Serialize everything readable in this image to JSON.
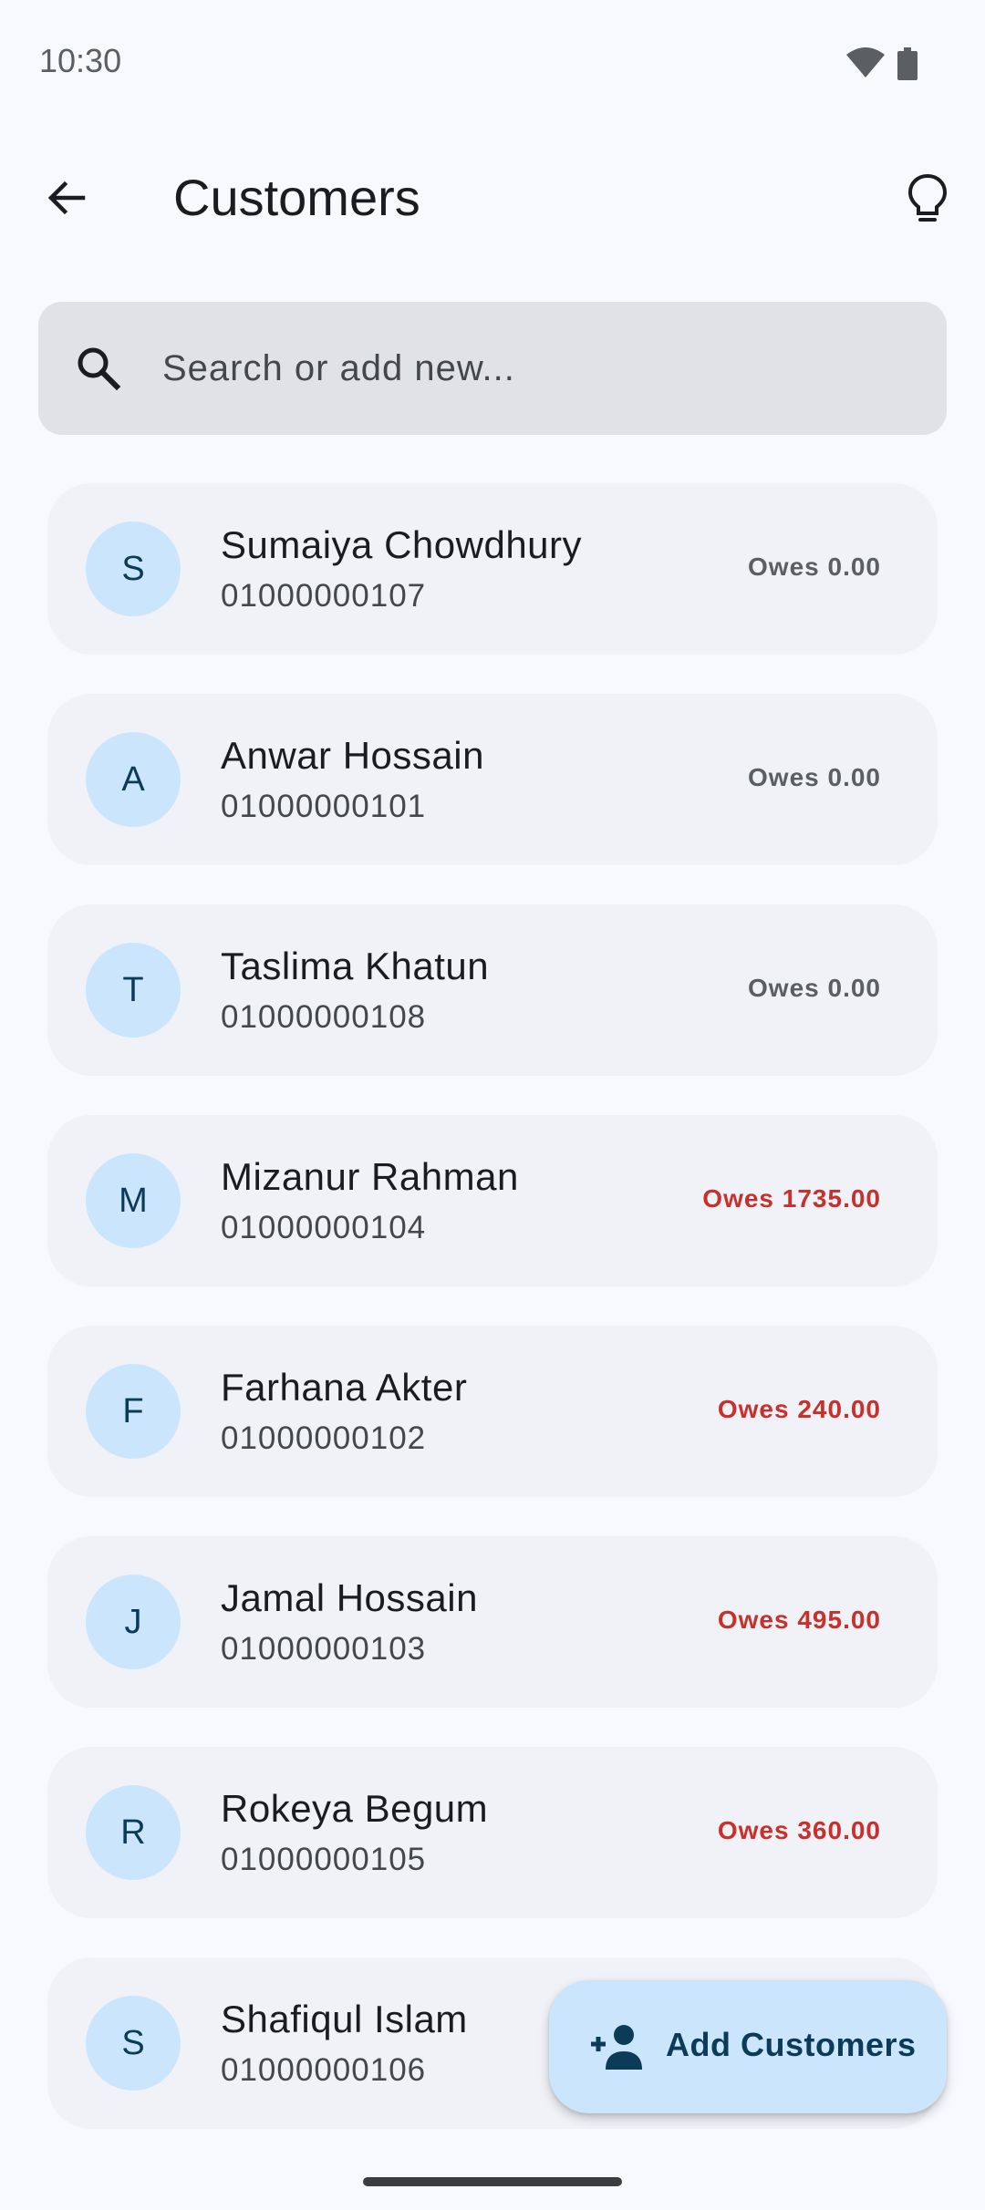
{
  "status_bar": {
    "time": "10:30",
    "icons": [
      "wifi-icon",
      "battery-icon"
    ]
  },
  "app_bar": {
    "title": "Customers",
    "back_icon": "arrow-left-icon",
    "action_icon": "lightbulb-icon"
  },
  "search": {
    "placeholder": "Search or add new...",
    "value": ""
  },
  "customers": [
    {
      "initial": "S",
      "name": "Sumaiya Chowdhury",
      "phone": "01000000107",
      "owes": "Owes 0.00"
    },
    {
      "initial": "A",
      "name": "Anwar Hossain",
      "phone": "01000000101",
      "owes": "Owes 0.00"
    },
    {
      "initial": "T",
      "name": "Taslima Khatun",
      "phone": "01000000108",
      "owes": "Owes 0.00"
    },
    {
      "initial": "M",
      "name": "Mizanur Rahman",
      "phone": "01000000104",
      "owes": "Owes 1735.00"
    },
    {
      "initial": "F",
      "name": "Farhana Akter",
      "phone": "01000000102",
      "owes": "Owes 240.00"
    },
    {
      "initial": "J",
      "name": "Jamal Hossain",
      "phone": "01000000103",
      "owes": "Owes 495.00"
    },
    {
      "initial": "R",
      "name": "Rokeya Begum",
      "phone": "01000000105",
      "owes": "Owes 360.00"
    },
    {
      "initial": "S",
      "name": "Shafiqul Islam",
      "phone": "01000000106",
      "owes": ""
    }
  ],
  "fab": {
    "label": "Add Customers",
    "icon": "person-add-icon"
  },
  "colors": {
    "background": "#f7f9fe",
    "card": "#f0f2f7",
    "avatar_bg": "#cbe6fc",
    "avatar_text": "#0c3b57",
    "owes_zero": "#5b5e63",
    "owes_due": "#c9302c",
    "fab_bg": "#cbe6fc"
  }
}
